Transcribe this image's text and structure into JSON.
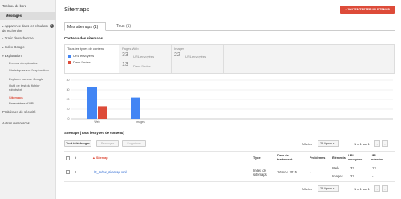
{
  "sidebar": {
    "dashboard": "Tableau de bord",
    "messages": "Messages",
    "search_appearance": "Apparence dans les résultats de recherche",
    "search_appearance_badge": "1",
    "search_traffic": "Trafic de recherche",
    "google_index": "Index Google",
    "crawl": "Exploration",
    "crawl_errors": "Erreurs d'exploration",
    "crawl_stats": "Statistiques sur l'exploration",
    "fetch_as_google": "Explorer comme Google",
    "robots_tester": "Outil de test du fichier robots.txt",
    "sitemaps": "Sitemaps",
    "url_params": "Paramètres d'URL",
    "security_issues": "Problèmes de sécurité",
    "other_resources": "Autres ressources"
  },
  "header": {
    "title": "Sitemaps",
    "add_test_button": "AJOUTER/TESTER UN SITEMAP"
  },
  "tabs": [
    {
      "label": "Mes sitemaps (1)"
    },
    {
      "label": "Tous (1)"
    }
  ],
  "contents": {
    "title": "Contenu des sitemaps",
    "all_types": "Tous les types de contenu",
    "submitted_label": "URL envoyées",
    "indexed_label": "Dans l'index",
    "pages": {
      "title": "Pages Web",
      "submitted": "33",
      "submitted_label": "URL envoyées",
      "indexed": "13",
      "indexed_label": "Dans l'index"
    },
    "images": {
      "title": "Images",
      "submitted": "22",
      "submitted_label": "URL envoyées"
    }
  },
  "colors": {
    "submitted": "#4285f4",
    "indexed": "#dd4b39",
    "accent": "#dd4b39"
  },
  "chart_data": {
    "type": "bar",
    "categories": [
      "Web",
      "Images"
    ],
    "series": [
      {
        "name": "URL envoyées",
        "values": [
          33,
          22
        ]
      },
      {
        "name": "Dans l'index",
        "values": [
          13,
          0
        ]
      }
    ],
    "ylim": [
      0,
      40
    ],
    "yticks": [
      "40",
      "30",
      "20",
      "10",
      "0"
    ],
    "grid": true
  },
  "sitemaps_table": {
    "title": "Sitemaps (Tous les types de contenu)",
    "download_all": "Tout télécharger",
    "resubmit": "Renvoyer",
    "delete": "Supprimer",
    "show_label": "Afficher",
    "rows_per_page": "25 lignes",
    "range": "1 à 1 sur 1",
    "columns": {
      "number": "#",
      "sitemap": "Sitemap",
      "type": "Type",
      "processed": "Date de traitement",
      "issues": "Problèmes",
      "items": "Éléments",
      "submitted": "URL envoyées",
      "indexed": "URL indexées"
    },
    "rows": [
      {
        "number": "1",
        "sitemap": "/?_index_sitemap.xml",
        "type": "Index de sitemaps",
        "processed": "16 nov. 2015",
        "issues": "-",
        "items": [
          {
            "label": "Web",
            "submitted": "33",
            "indexed": "13"
          },
          {
            "label": "Images",
            "submitted": "22",
            "indexed": "-"
          }
        ]
      }
    ]
  }
}
